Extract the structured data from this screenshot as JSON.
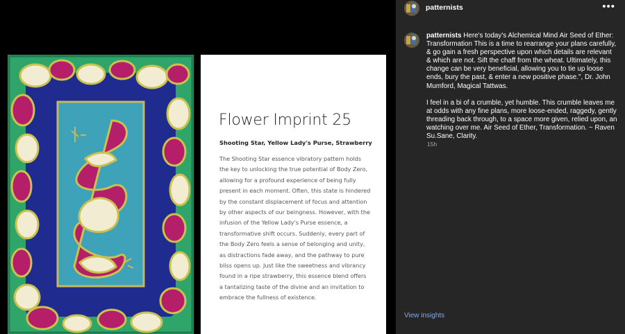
{
  "colors": {
    "panel_bg": "#262626",
    "link": "#85a7f0",
    "art_green": "#2fa56a",
    "art_blue": "#1f2b8e",
    "art_teal": "#3ea3b8",
    "art_magenta": "#b51f6a",
    "art_cream": "#f2ecd2"
  },
  "icons": {
    "more": "more-options-icon",
    "avatar": "avatar"
  },
  "card": {
    "title": "Flower Imprint 25",
    "subtitle": "Shooting Star, Yellow Lady's Purse, Strawberry",
    "body": "The Shooting Star essence vibratory pattern holds the key to unlocking the true potential of Body Zero, allowing for a profound experience of being fully present in each moment. Often, this state is hindered by the constant displacement of focus and attention by other aspects of our beingness. However, with the infusion of the Yellow Lady's Purse essence, a transformative shift occurs. Suddenly, every part of the Body Zero feels a sense of belonging and unity, as distractions fade away, and the pathway to pure bliss opens up. Just like the sweetness and vibrancy found in a ripe strawberry, this essence blend offers a tantalizing taste of the divine and an invitation to embrace the fullness of existence."
  },
  "header": {
    "username": "patternists",
    "more_label": "•••"
  },
  "post": {
    "username": "patternists",
    "caption_p1": "Here's today's Alchemical Mind Air Seed of Ether: Transformation This is a time to rearrange your plans carefully, & go gain a fresh perspective upon which details are relevant & which are not. Sift the chaff from the wheat. Ultimately, this change can be very beneficial, allowing you to tie up loose ends, bury the past, & enter a new positive phase.\", Dr. John Mumford, Magical Tattwas.",
    "caption_p2": "I feel in a bi of a crumble, yet humble. This crumble leaves me at odds with any fine plans, more loose-ended, raggedy, gently threading back through, to a space more given, relied upon, an watching over me. Air Seed of Ether, Transformation. ~ Raven Su.Sane, Clarity.",
    "time": "15h",
    "insights_label": "View insights"
  }
}
